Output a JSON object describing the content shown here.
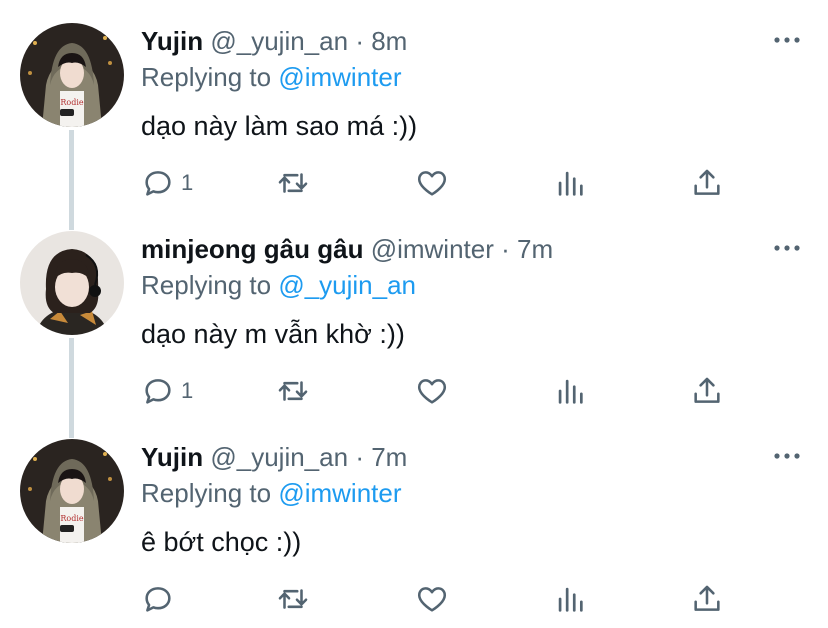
{
  "tweets": [
    {
      "name": "Yujin",
      "handle": "@_yujin_an",
      "dot": "·",
      "time": "8m",
      "replying_prefix": "Replying to",
      "replying_to": "@imwinter",
      "text": "dạo này làm sao má :))",
      "reply_count": "1"
    },
    {
      "name": "minjeong gâu gâu",
      "handle": "@imwinter",
      "dot": "·",
      "time": "7m",
      "replying_prefix": "Replying to",
      "replying_to": "@_yujin_an",
      "text": "dạo này m vẫn khờ :))",
      "reply_count": "1"
    },
    {
      "name": "Yujin",
      "handle": "@_yujin_an",
      "dot": "·",
      "time": "7m",
      "replying_prefix": "Replying to",
      "replying_to": "@imwinter",
      "text": "ê bớt chọc :))",
      "reply_count": ""
    }
  ],
  "icons": {
    "reply": "reply-icon",
    "retweet": "retweet-icon",
    "like": "heart-icon",
    "stats": "stats-icon",
    "share": "share-icon",
    "more": "more-icon"
  },
  "colors": {
    "text": "#0f1419",
    "secondary": "#536471",
    "mention": "#1d9bf0",
    "thread_line": "#cfd9de"
  }
}
